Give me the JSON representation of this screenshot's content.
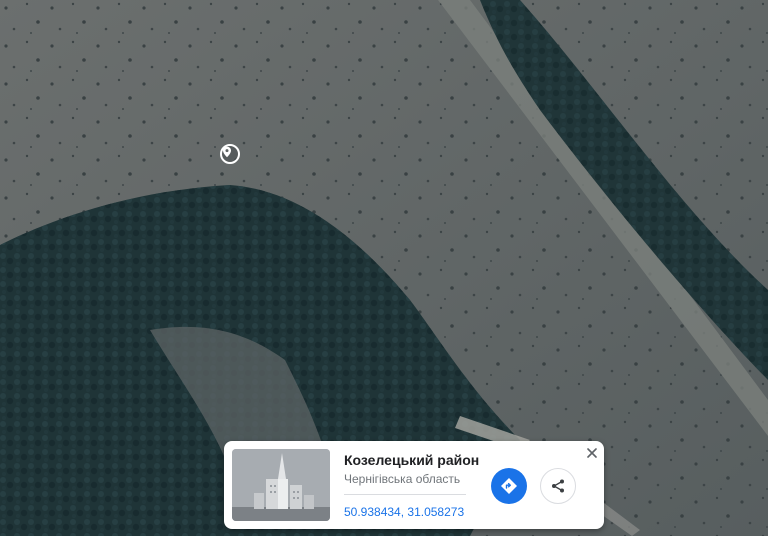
{
  "place_card": {
    "title": "Козелецький район",
    "subtitle": "Чернігівська область",
    "coordinates": "50.938434, 31.058273"
  },
  "icons": {
    "pin": "location-pin-icon",
    "close": "close-icon",
    "directions": "directions-icon",
    "share": "share-icon",
    "thumbnail": "city-buildings-illustration"
  },
  "colors": {
    "accent": "#1a73e8",
    "card_background": "#ffffff",
    "title_text": "#202124",
    "subtitle_text": "#70757a",
    "field": "#5f6464",
    "forest": "#1e3236"
  }
}
